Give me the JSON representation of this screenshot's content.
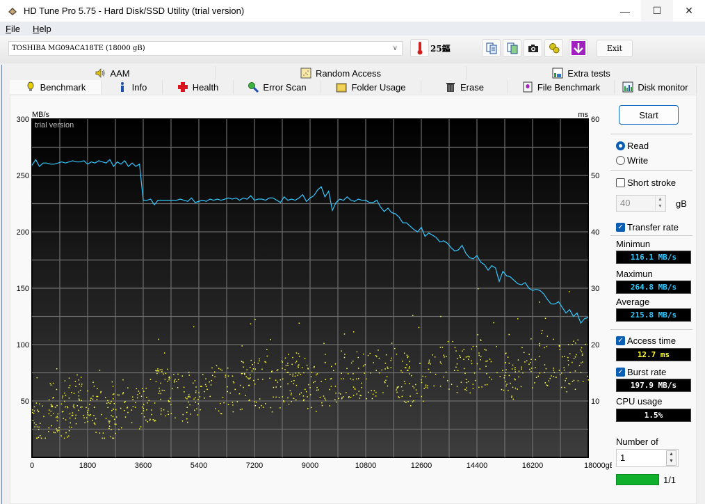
{
  "window": {
    "title": "HD Tune Pro 5.75 - Hard Disk/SSD Utility (trial version)",
    "controls": {
      "minimize": "—",
      "maximize": "☐",
      "close": "✕"
    }
  },
  "menu": {
    "items": [
      {
        "label": "File",
        "accel": "F",
        "rest": "ile"
      },
      {
        "label": "Help",
        "accel": "H",
        "rest": "elp"
      }
    ]
  },
  "toolbar": {
    "drive": "TOSHIBA MG09ACA18TE (18000 gB)",
    "temperature": "25鏂",
    "icons": [
      "copy-info-icon",
      "copy-screen-icon",
      "screenshot-camera-icon",
      "options-icon",
      "save-download-icon"
    ],
    "exit_label": "Exit"
  },
  "tabs": {
    "row1": [
      {
        "label": "AAM",
        "icon": "speaker-icon"
      },
      {
        "label": "Random Access",
        "icon": "random-access-icon"
      },
      {
        "label": "Extra tests",
        "icon": "extra-tests-icon"
      }
    ],
    "row2": [
      {
        "label": "Benchmark",
        "icon": "lightbulb-icon",
        "active": true
      },
      {
        "label": "Info",
        "icon": "info-icon"
      },
      {
        "label": "Health",
        "icon": "health-cross-icon"
      },
      {
        "label": "Error Scan",
        "icon": "magnifier-icon"
      },
      {
        "label": "Folder Usage",
        "icon": "folder-icon"
      },
      {
        "label": "Erase",
        "icon": "trash-icon"
      },
      {
        "label": "File Benchmark",
        "icon": "file-benchmark-icon"
      },
      {
        "label": "Disk monitor",
        "icon": "disk-monitor-icon"
      }
    ]
  },
  "sidebar": {
    "start_label": "Start",
    "read_label": "Read",
    "write_label": "Write",
    "mode": "Read",
    "short_stroke_label": "Short stroke",
    "short_stroke_checked": false,
    "short_stroke_value": "40",
    "short_stroke_unit": "gB",
    "transfer_rate_label": "Transfer rate",
    "transfer_rate_checked": true,
    "minimum_label": "Minimun",
    "minimum_value": "116.1 MB/s",
    "maximum_label": "Maximun",
    "maximum_value": "264.8 MB/s",
    "average_label": "Average",
    "average_value": "215.8 MB/s",
    "access_time_label": "Access time",
    "access_time_checked": true,
    "access_time_value": "12.7 ms",
    "burst_rate_label": "Burst rate",
    "burst_rate_checked": true,
    "burst_rate_value": "197.9 MB/s",
    "cpu_usage_label": "CPU usage",
    "cpu_usage_value": "1.5%",
    "number_of_label": "Number of",
    "number_of_value": "1",
    "progress_fraction": 1.0,
    "progress_text": "1/1",
    "colors": {
      "transfer": "#33c8ff",
      "access": "#ffff33",
      "burst": "#ffffff",
      "progress": "#10b02c"
    }
  },
  "chart_data": {
    "type": "line",
    "title": "",
    "watermark": "trial version",
    "ylabel": "MB/s",
    "y2label": "ms",
    "xlabel": "gB",
    "xlim": [
      0,
      18000
    ],
    "ylim": [
      0,
      300
    ],
    "y2lim": [
      0,
      60
    ],
    "xticks": [
      0,
      1800,
      3600,
      5400,
      7200,
      9000,
      10800,
      12600,
      14400,
      16200,
      18000
    ],
    "xtick_labels": [
      "0",
      "1800",
      "3600",
      "5400",
      "7200",
      "9000",
      "10800",
      "12600",
      "14400",
      "16200",
      "18000gB"
    ],
    "yticks": [
      50,
      100,
      150,
      200,
      250,
      300
    ],
    "y2ticks": [
      10,
      20,
      30,
      40,
      50,
      60
    ],
    "grid": true,
    "series": [
      {
        "name": "Transfer rate",
        "axis": "left",
        "color": "#33c8ff",
        "x_step": 200,
        "values": [
          259,
          264,
          258,
          261,
          261,
          260,
          260,
          261,
          262,
          261,
          262,
          263,
          262,
          262,
          263,
          260,
          262,
          261,
          263,
          262,
          261,
          264,
          258,
          262,
          260,
          263,
          258,
          261,
          258,
          260,
          228,
          228,
          229,
          224,
          228,
          228,
          228,
          228,
          228,
          228,
          229,
          228,
          227,
          230,
          226,
          227,
          228,
          227,
          229,
          228,
          229,
          228,
          229,
          230,
          229,
          230,
          228,
          230,
          229,
          232,
          228,
          229,
          229,
          228,
          230,
          230,
          228,
          226,
          231,
          228,
          229,
          228,
          230,
          233,
          227,
          230,
          232,
          237,
          240,
          231,
          236,
          219,
          226,
          229,
          228,
          231,
          228,
          227,
          229,
          228,
          228,
          226,
          226,
          228,
          222,
          218,
          221,
          217,
          216,
          213,
          208,
          208,
          205,
          202,
          200,
          204,
          196,
          199,
          197,
          195,
          191,
          192,
          190,
          186,
          183,
          184,
          188,
          181,
          177,
          176,
          179,
          173,
          171,
          166,
          170,
          168,
          156,
          165,
          161,
          160,
          157,
          154,
          153,
          155,
          150,
          148,
          149,
          148,
          145,
          140,
          136,
          136,
          138,
          133,
          128,
          131,
          125,
          128,
          119,
          123,
          124
        ]
      },
      {
        "name": "Access time",
        "axis": "right",
        "color": "#ffff33",
        "type": "scatter",
        "summary": {
          "mean_ms": 12.7,
          "min_ms": 3.5,
          "max_ms": 30
        },
        "points_sample": [
          [
            0,
            8.5
          ],
          [
            200,
            5
          ],
          [
            600,
            9.5
          ],
          [
            1000,
            7
          ],
          [
            1500,
            11
          ],
          [
            2000,
            9
          ],
          [
            2500,
            6.5
          ],
          [
            3000,
            10
          ],
          [
            3600,
            9.5
          ],
          [
            4200,
            12
          ],
          [
            5000,
            10.5
          ],
          [
            5600,
            13
          ],
          [
            6400,
            11.5
          ],
          [
            7000,
            14
          ],
          [
            7800,
            12.5
          ],
          [
            8500,
            14.5
          ],
          [
            9200,
            12
          ],
          [
            10000,
            15
          ],
          [
            10800,
            14
          ],
          [
            11600,
            16
          ],
          [
            12400,
            13
          ],
          [
            13200,
            17
          ],
          [
            14000,
            15
          ],
          [
            14800,
            17.5
          ],
          [
            15600,
            14
          ],
          [
            16400,
            18
          ],
          [
            17200,
            16
          ],
          [
            17800,
            17
          ]
        ]
      }
    ]
  }
}
